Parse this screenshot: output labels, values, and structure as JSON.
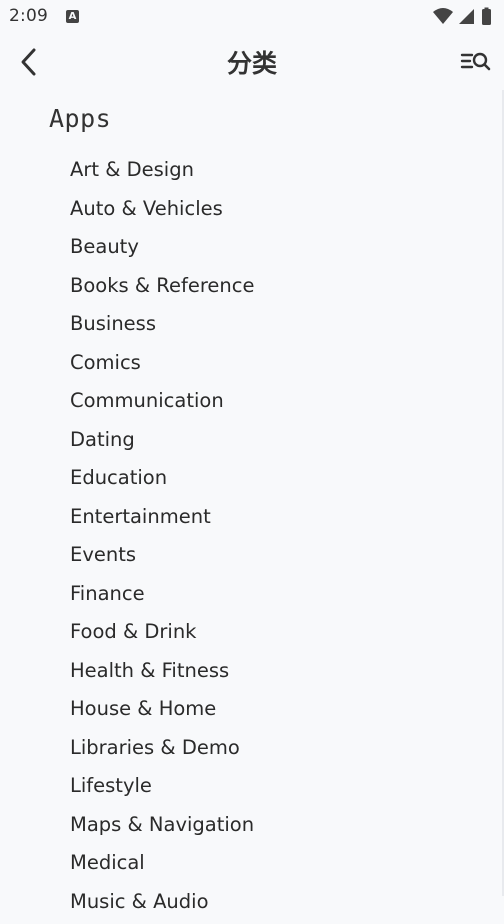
{
  "status_bar": {
    "time": "2:09",
    "app_icon": "A"
  },
  "toolbar": {
    "title": "分类",
    "back_icon": "chevron-left-icon",
    "search_icon": "list-search-icon"
  },
  "section": {
    "title": "Apps"
  },
  "categories": [
    "Art & Design",
    "Auto & Vehicles",
    "Beauty",
    "Books & Reference",
    "Business",
    "Comics",
    "Communication",
    "Dating",
    "Education",
    "Entertainment",
    "Events",
    "Finance",
    "Food & Drink",
    "Health & Fitness",
    "House & Home",
    "Libraries & Demo",
    "Lifestyle",
    "Maps & Navigation",
    "Medical",
    "Music & Audio"
  ]
}
